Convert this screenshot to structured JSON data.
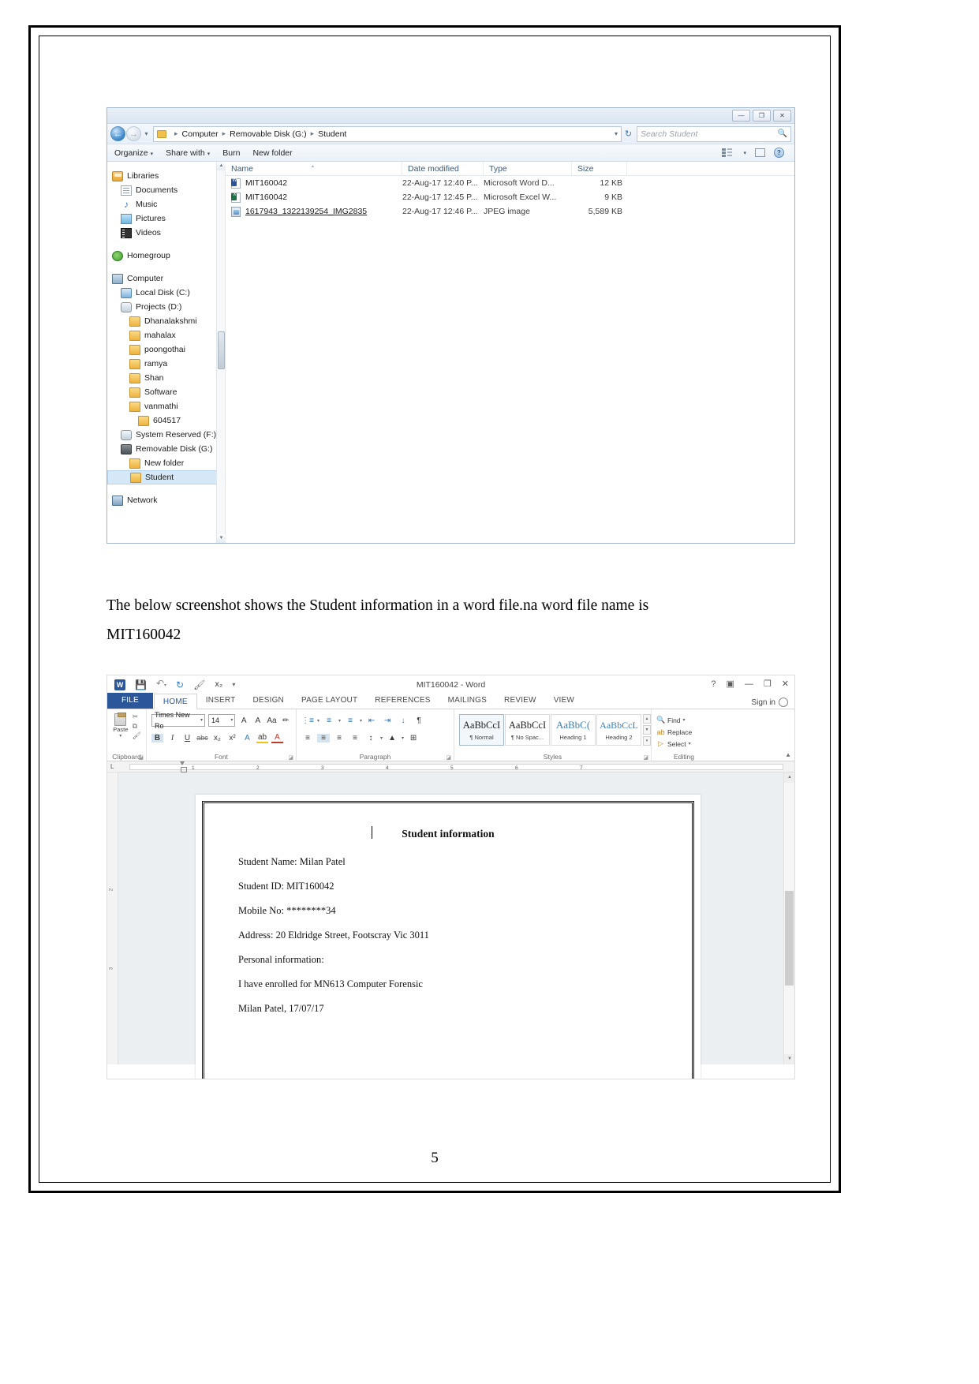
{
  "document": {
    "page_number": "5",
    "caption_line1": "The below screenshot shows the Student information in a word file.na word file name is",
    "caption_line2": " MIT160042"
  },
  "explorer": {
    "window_controls": {
      "minimize": "—",
      "maximize": "❐",
      "close": "✕"
    },
    "address": {
      "crumbs": [
        "Computer",
        "Removable Disk (G:)",
        "Student"
      ],
      "separator": "▸",
      "dropdown_caret": "▾",
      "refresh_icon": "↻"
    },
    "search": {
      "placeholder": "Search Student",
      "icon": "search-icon"
    },
    "toolbar": {
      "organize": "Organize",
      "share_with": "Share with",
      "burn": "Burn",
      "new_folder": "New folder",
      "caret": "▾"
    },
    "nav_tree": [
      {
        "label": "Libraries",
        "icon": "libraries-icon",
        "indent": 0,
        "selected": false
      },
      {
        "label": "Documents",
        "icon": "document-icon",
        "indent": 1,
        "selected": false
      },
      {
        "label": "Music",
        "icon": "music-icon",
        "indent": 1,
        "selected": false
      },
      {
        "label": "Pictures",
        "icon": "pictures-icon",
        "indent": 1,
        "selected": false
      },
      {
        "label": "Videos",
        "icon": "videos-icon",
        "indent": 1,
        "selected": false
      },
      {
        "label": "Homegroup",
        "icon": "homegroup-icon",
        "indent": 0,
        "selected": false
      },
      {
        "label": "Computer",
        "icon": "computer-icon",
        "indent": 0,
        "selected": false
      },
      {
        "label": "Local Disk (C:)",
        "icon": "disk-c-icon",
        "indent": 1,
        "selected": false
      },
      {
        "label": "Projects (D:)",
        "icon": "disk-icon",
        "indent": 1,
        "selected": false
      },
      {
        "label": "Dhanalakshmi",
        "icon": "folder-icon",
        "indent": 2,
        "selected": false
      },
      {
        "label": "mahalax",
        "icon": "folder-icon",
        "indent": 2,
        "selected": false
      },
      {
        "label": "poongothai",
        "icon": "folder-icon",
        "indent": 2,
        "selected": false
      },
      {
        "label": "ramya",
        "icon": "folder-icon",
        "indent": 2,
        "selected": false
      },
      {
        "label": "Shan",
        "icon": "folder-icon",
        "indent": 2,
        "selected": false
      },
      {
        "label": "Software",
        "icon": "folder-icon",
        "indent": 2,
        "selected": false
      },
      {
        "label": "vanmathi",
        "icon": "folder-icon",
        "indent": 2,
        "selected": false
      },
      {
        "label": "604517",
        "icon": "folder-icon",
        "indent": 3,
        "selected": false
      },
      {
        "label": "System Reserved (F:)",
        "icon": "disk-icon",
        "indent": 1,
        "selected": false
      },
      {
        "label": "Removable Disk (G:)",
        "icon": "usb-icon",
        "indent": 1,
        "selected": false
      },
      {
        "label": "New folder",
        "icon": "folder-icon",
        "indent": 2,
        "selected": false
      },
      {
        "label": "Student",
        "icon": "folder-icon",
        "indent": 2,
        "selected": true
      },
      {
        "label": "Network",
        "icon": "network-icon",
        "indent": 0,
        "selected": false
      }
    ],
    "columns": [
      "Name",
      "Date modified",
      "Type",
      "Size"
    ],
    "files": [
      {
        "name": "MIT160042",
        "icon": "word-file-icon",
        "date": "22-Aug-17 12:40 P...",
        "type": "Microsoft Word D...",
        "size": "12 KB"
      },
      {
        "name": "MIT160042",
        "icon": "excel-file-icon",
        "date": "22-Aug-17 12:45 P...",
        "type": "Microsoft Excel W...",
        "size": "9 KB"
      },
      {
        "name": "1617943_1322139254_IMG2835",
        "icon": "image-file-icon",
        "date": "22-Aug-17 12:46 P...",
        "type": "JPEG image",
        "size": "5,589 KB"
      }
    ]
  },
  "word": {
    "title": "MIT160042 - Word",
    "quick_access": [
      "save-icon",
      "undo-icon",
      "redo-icon",
      "format-painter-icon",
      "subscript-icon",
      "customize-caret"
    ],
    "window_controls": {
      "help": "?",
      "ribbon_display": "▣",
      "minimize": "—",
      "restore": "❐",
      "close": "✕"
    },
    "sign_in": "Sign in",
    "tabs": [
      {
        "label": "FILE",
        "active": false,
        "is_file": true
      },
      {
        "label": "HOME",
        "active": true,
        "is_file": false
      },
      {
        "label": "INSERT",
        "active": false,
        "is_file": false
      },
      {
        "label": "DESIGN",
        "active": false,
        "is_file": false
      },
      {
        "label": "PAGE LAYOUT",
        "active": false,
        "is_file": false
      },
      {
        "label": "REFERENCES",
        "active": false,
        "is_file": false
      },
      {
        "label": "MAILINGS",
        "active": false,
        "is_file": false
      },
      {
        "label": "REVIEW",
        "active": false,
        "is_file": false
      },
      {
        "label": "VIEW",
        "active": false,
        "is_file": false
      }
    ],
    "ribbon": {
      "clipboard": {
        "label": "Clipboard",
        "paste": "Paste",
        "paste_caret": "▾",
        "cut_icon": "✂",
        "copy_icon": "⧉",
        "painter_icon": "🖌",
        "dialog": "◪"
      },
      "font": {
        "label": "Font",
        "font_name": "Times New Ro",
        "font_size": "14",
        "grow": "A",
        "shrink": "A",
        "case": "Aa",
        "clear_format": "✏",
        "bold": "B",
        "italic": "I",
        "underline": "U",
        "strike": "abc",
        "subscript": "x₂",
        "superscript": "x²",
        "text_effects": "A",
        "highlight": "ab",
        "font_color": "A",
        "caret": "▾",
        "dialog": "◪"
      },
      "paragraph": {
        "label": "Paragraph",
        "bullets": "⋮≡",
        "numbering": "≡",
        "multilevel": "≡",
        "decrease_indent": "⇤",
        "increase_indent": "⇥",
        "sort": "↓",
        "show_marks": "¶",
        "align_left": "≡",
        "align_center": "≡",
        "align_right": "≡",
        "justify": "≡",
        "line_spacing": "↕",
        "shading": "▲",
        "borders": "⊞",
        "dialog": "◪"
      },
      "styles": {
        "label": "Styles",
        "items": [
          {
            "sample": "AaBbCcI",
            "name": "¶ Normal",
            "selected": true,
            "kind": "normal"
          },
          {
            "sample": "AaBbCcI",
            "name": "¶ No Spac...",
            "selected": false,
            "kind": "normal"
          },
          {
            "sample": "AaBbC(",
            "name": "Heading 1",
            "selected": false,
            "kind": "h1"
          },
          {
            "sample": "AaBbCcL",
            "name": "Heading 2",
            "selected": false,
            "kind": "h2"
          }
        ],
        "scroll_up": "▲",
        "scroll_down": "▼",
        "more": "▾",
        "dialog": "◪"
      },
      "editing": {
        "label": "Editing",
        "find": "Find",
        "replace": "Replace",
        "select": "Select",
        "caret": "▾",
        "select_caret": "▾"
      },
      "collapse_icon": "▲"
    },
    "ruler": {
      "corner_icon": "L",
      "marks": [
        "1",
        "2",
        "3",
        "4",
        "5",
        "6",
        "7"
      ],
      "left_marks": [
        "1"
      ]
    },
    "vertical_ruler_marks": [
      "2",
      "3"
    ],
    "document_content": {
      "title": "Student information",
      "lines": [
        "Student Name: Milan Patel",
        "Student ID: MIT160042",
        "Mobile No: ********34",
        "Address: 20 Eldridge Street, Footscray Vic 3011",
        "Personal information:",
        "I have enrolled for MN613 Computer Forensic",
        "Milan Patel, 17/07/17"
      ]
    },
    "scrollbar": {
      "up": "▲",
      "down": "▼"
    }
  }
}
